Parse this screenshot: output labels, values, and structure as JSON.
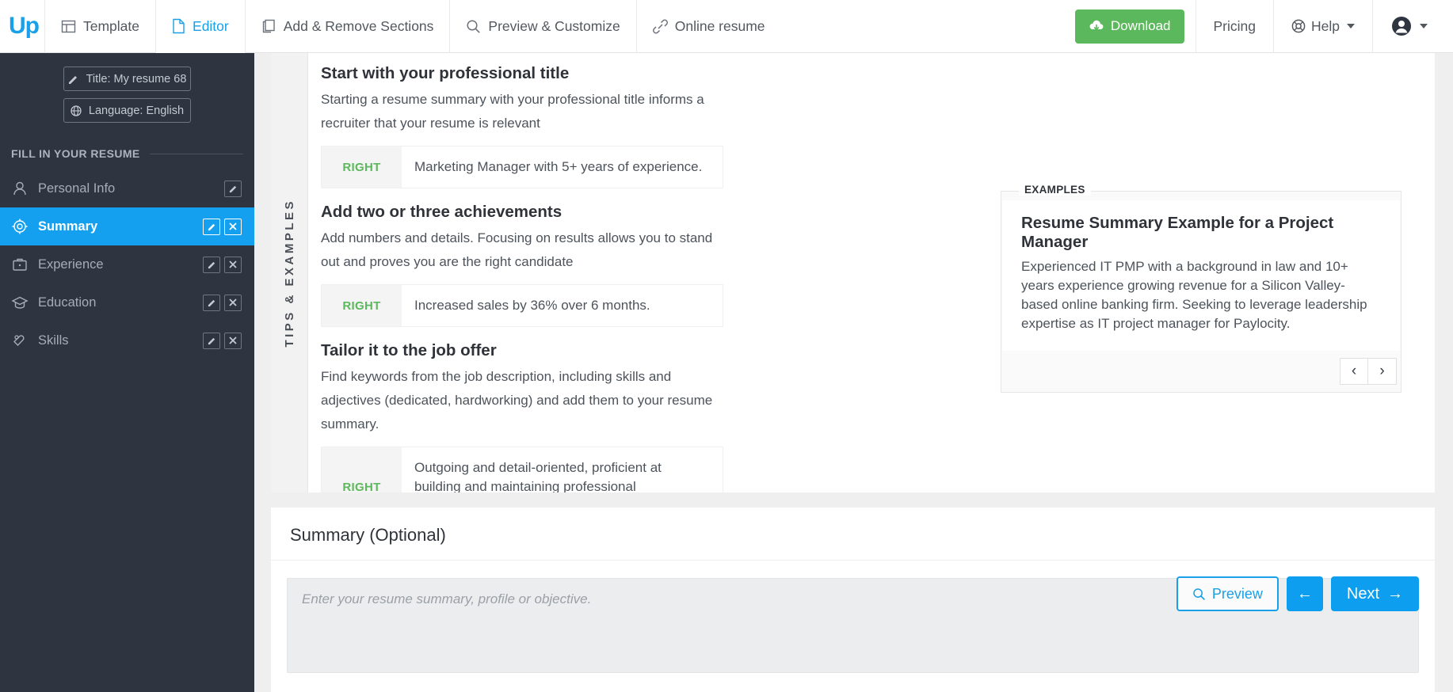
{
  "topnav": {
    "logo": "Up",
    "items": [
      {
        "label": "Template",
        "icon": "template-icon",
        "active": false
      },
      {
        "label": "Editor",
        "icon": "document-icon",
        "active": true
      },
      {
        "label": "Add & Remove Sections",
        "icon": "copy-icon",
        "active": false
      },
      {
        "label": "Preview & Customize",
        "icon": "search-icon",
        "active": false
      },
      {
        "label": "Online resume",
        "icon": "link-icon",
        "active": false
      }
    ],
    "download_label": "Download",
    "download_icon": "cloud-download-icon",
    "pricing_label": "Pricing",
    "help_label": "Help",
    "help_icon": "lifebuoy-icon",
    "account_icon": "user-avatar-icon",
    "accent_green": "#5cb85c",
    "accent_blue": "#19a0e8"
  },
  "sidebar": {
    "title_button": {
      "label": "Title: My resume 68",
      "icon": "pencil-icon"
    },
    "language_button": {
      "label": "Language: English",
      "icon": "globe-icon"
    },
    "section_label": "FILL IN YOUR RESUME",
    "items": [
      {
        "label": "Personal Info",
        "icon": "person-icon",
        "active": false,
        "edit": true,
        "remove": false
      },
      {
        "label": "Summary",
        "icon": "target-icon",
        "active": true,
        "edit": true,
        "remove": true
      },
      {
        "label": "Experience",
        "icon": "briefcase-icon",
        "active": false,
        "edit": true,
        "remove": true
      },
      {
        "label": "Education",
        "icon": "graduation-cap-icon",
        "active": false,
        "edit": true,
        "remove": true
      },
      {
        "label": "Skills",
        "icon": "tag-heart-icon",
        "active": false,
        "edit": true,
        "remove": true
      }
    ],
    "background": "#2e3440",
    "active_color": "#14a0ee"
  },
  "tips": {
    "rail_label": "TIPS & EXAMPLES",
    "right_tag": "RIGHT",
    "entries": [
      {
        "heading": "Start with your professional title",
        "text": "Starting a resume summary with your professional title informs a recruiter that your resume is relevant",
        "example": "Marketing Manager with 5+ years of experience."
      },
      {
        "heading": "Add two or three achievements",
        "text": "Add numbers and details. Focusing on results allows you to stand out and proves you are the right candidate",
        "example": "Increased sales by 36% over 6 months."
      },
      {
        "heading": "Tailor it to the job offer",
        "text": "Find keywords from the job description, including skills and adjectives (dedicated, hardworking) and add them to your resume summary.",
        "example": "Outgoing and detail-oriented, proficient at building and maintaining professional relationships."
      }
    ]
  },
  "examples": {
    "legend": "EXAMPLES",
    "title": "Resume Summary Example for a Project Manager",
    "text": "Experienced IT PMP with a background in law and 10+ years experience growing revenue for a Silicon Valley-based online banking firm. Seeking to leverage leadership expertise as IT project manager for Paylocity.",
    "prev_icon": "chevron-left-icon",
    "next_icon": "chevron-right-icon"
  },
  "summary_section": {
    "title": "Summary (Optional)",
    "input_value": "",
    "input_placeholder": "Enter your resume summary, profile or objective.",
    "preview_label": "Preview",
    "preview_icon": "search-icon",
    "back_label": "←",
    "next_label": "Next",
    "next_icon": "arrow-right-icon"
  }
}
